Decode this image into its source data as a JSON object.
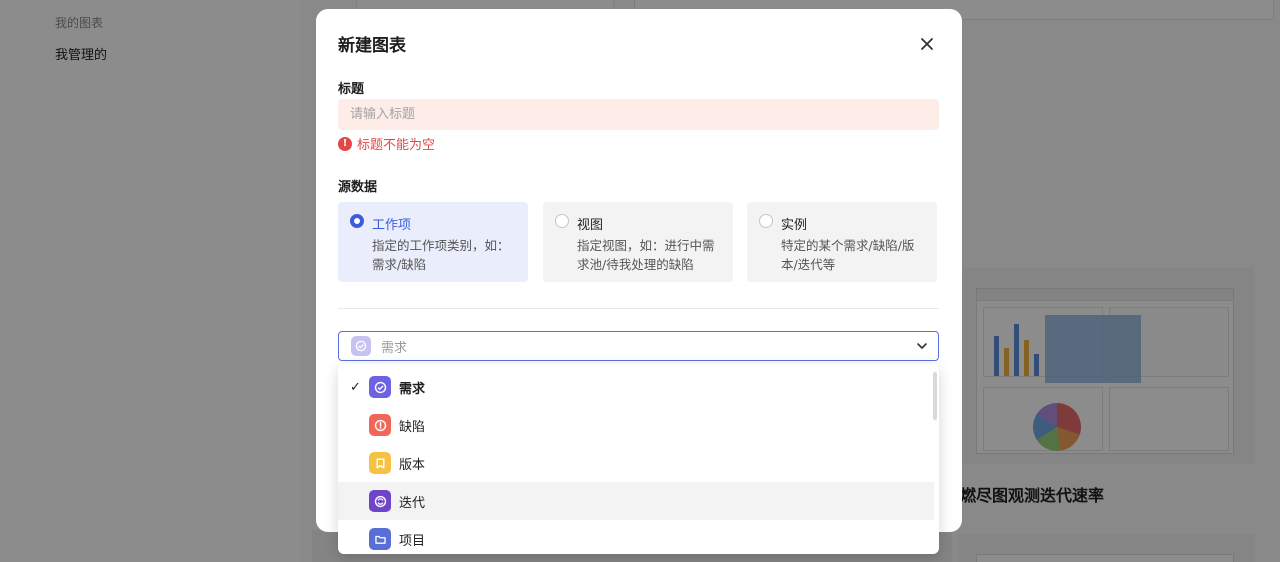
{
  "background": {
    "sidebar": {
      "section_label": "我的图表",
      "menu_item": "我管理的"
    },
    "card_title_partial": "燃尽图观测迭代速率"
  },
  "modal": {
    "title": "新建图表",
    "close_icon": "close-icon",
    "title_field": {
      "label": "标题",
      "placeholder": "请输入标题",
      "value": "",
      "error": "标题不能为空"
    },
    "source": {
      "label": "源数据",
      "options": [
        {
          "title": "工作项",
          "desc": "指定的工作项类别，如：需求/缺陷",
          "checked": true
        },
        {
          "title": "视图",
          "desc": "指定视图，如：进行中需求池/待我处理的缺陷",
          "checked": false
        },
        {
          "title": "实例",
          "desc": "特定的某个需求/缺陷/版本/迭代等",
          "checked": false
        }
      ]
    },
    "type_select": {
      "selected": "需求",
      "icon": "requirement-icon"
    }
  },
  "dropdown": {
    "items": [
      {
        "label": "需求",
        "icon": "requirement-icon",
        "color": "#6c62e2",
        "selected": true
      },
      {
        "label": "缺陷",
        "icon": "bug-icon",
        "color": "#f0675a",
        "selected": false
      },
      {
        "label": "版本",
        "icon": "version-icon",
        "color": "#f5c244",
        "selected": false
      },
      {
        "label": "迭代",
        "icon": "iteration-icon",
        "color": "#6e44c9",
        "selected": false,
        "hovered": true
      },
      {
        "label": "项目",
        "icon": "project-icon",
        "color": "#5a6fd6",
        "selected": false
      }
    ]
  },
  "colors": {
    "accent": "#3c5cdc",
    "error": "#e34848",
    "error_bg": "#fdece8"
  }
}
